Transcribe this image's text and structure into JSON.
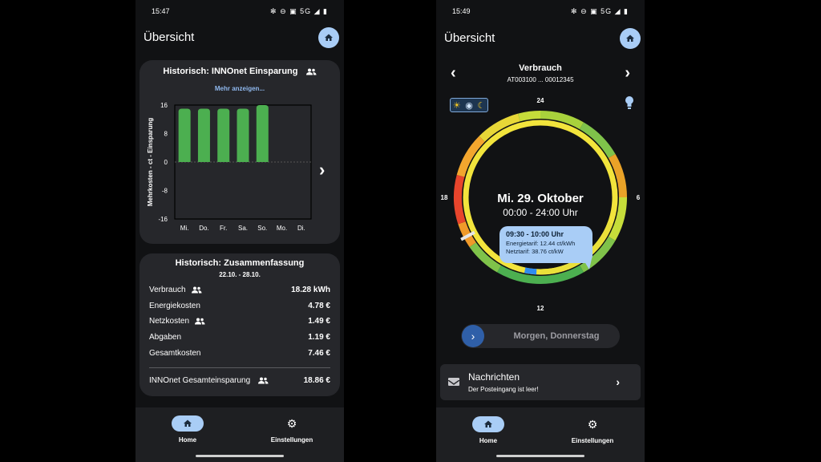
{
  "phone1": {
    "status": {
      "time": "15:47",
      "icons": "✻ ⊖ ▣ 5G ◢ ▮"
    },
    "appbar": {
      "title": "Übersicht"
    },
    "card1": {
      "title": "Historisch: INNOnet Einsparung",
      "more_link": "Mehr anzeigen...",
      "next_label": "›"
    },
    "card2": {
      "title": "Historisch: Zusammenfassung",
      "date_range": "22.10. - 28.10.",
      "rows": [
        {
          "label": "Verbrauch",
          "value": "18.28 kWh",
          "group_icon": true
        },
        {
          "label": "Energiekosten",
          "value": "4.78 €",
          "group_icon": false
        },
        {
          "label": "Netzkosten",
          "value": "1.49 €",
          "group_icon": true
        },
        {
          "label": "Abgaben",
          "value": "1.19 €",
          "group_icon": false
        },
        {
          "label": "Gesamtkosten",
          "value": "7.46 €",
          "group_icon": false
        }
      ],
      "total": {
        "label": "INNOnet Gesamteinsparung",
        "value": "18.86 €"
      }
    },
    "nav": {
      "home": "Home",
      "settings": "Einstellungen"
    }
  },
  "phone2": {
    "status": {
      "time": "15:49",
      "icons": "✻ ⊖ ▣ 5G ◢ ▮"
    },
    "appbar": {
      "title": "Übersicht"
    },
    "meter": {
      "title": "Verbrauch",
      "id": "AT003100 ... 00012345"
    },
    "clock": {
      "labels": {
        "top": "24",
        "right": "6",
        "bottom": "12",
        "left": "18"
      },
      "date": "Mi. 29. Oktober",
      "range": "00:00 - 24:00 Uhr",
      "tooltip": {
        "time": "09:30 - 10:00 Uhr",
        "energy": "Energietarif: 12.44 ct/kWh",
        "grid": "Netztarif: 38.76 ct/kW"
      }
    },
    "tomorrow_button": "Morgen, Donnerstag",
    "messages": {
      "title": "Nachrichten",
      "subtitle": "Der Posteingang ist leer!"
    },
    "nav": {
      "home": "Home",
      "settings": "Einstellungen"
    }
  },
  "chart_data": {
    "type": "bar",
    "categories": [
      "Mi.",
      "Do.",
      "Fr.",
      "Sa.",
      "So.",
      "Mo.",
      "Di."
    ],
    "values": [
      15,
      15,
      15,
      15,
      16,
      null,
      null
    ],
    "title": "",
    "xlabel": "",
    "ylabel": "Mehrkosten - ct - Einsparung",
    "ylim": [
      -16,
      16
    ],
    "yticks": [
      16,
      8,
      0,
      -8,
      -16
    ],
    "bar_color": "#4caf50"
  },
  "colors": {
    "accent": "#a9cdf6",
    "card": "#26272b",
    "bar": "#4caf50"
  }
}
